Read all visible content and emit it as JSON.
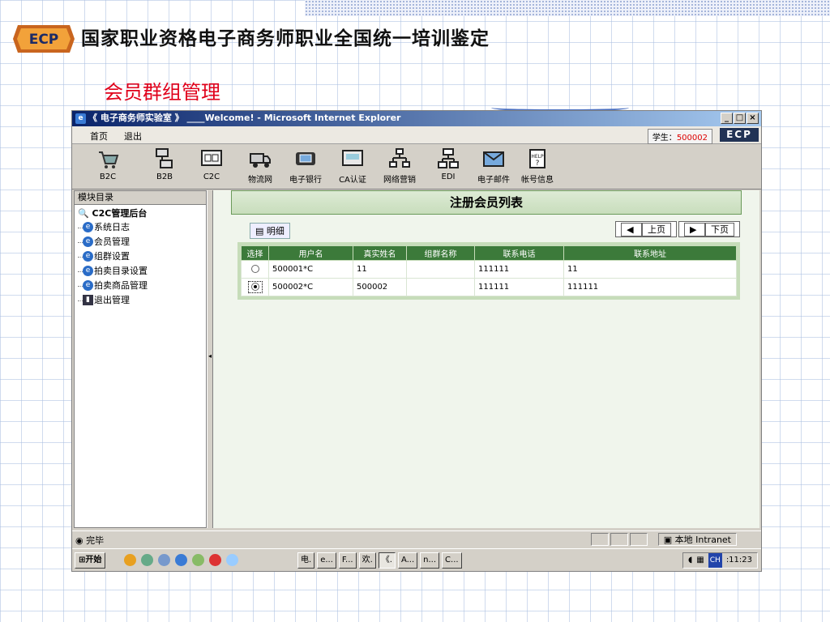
{
  "slide": {
    "title": "国家职业资格电子商务师职业全国统一培训鉴定",
    "subtitle": "会员群组管理",
    "logo_text": "ECP"
  },
  "window": {
    "title": "《 电子商务师实验室 》 ____Welcome! - Microsoft Internet Explorer",
    "controls": [
      "_",
      "□",
      "×"
    ]
  },
  "menubar": {
    "items": [
      "首页",
      "退出"
    ],
    "student_label": "学生：",
    "student_id": "500002",
    "brand": "ECP"
  },
  "toolbar": {
    "items": [
      {
        "label": "B2C",
        "icon": "cart-icon"
      },
      {
        "label": "B2B",
        "icon": "network-icon"
      },
      {
        "label": "C2C",
        "icon": "exchange-icon"
      },
      {
        "label": "物流网",
        "icon": "truck-icon"
      },
      {
        "label": "电子银行",
        "icon": "bank-icon"
      },
      {
        "label": "CA认证",
        "icon": "certificate-icon"
      },
      {
        "label": "网络营销",
        "icon": "marketing-icon"
      },
      {
        "label": "EDI",
        "icon": "edi-icon"
      },
      {
        "label": "电子邮件",
        "icon": "mail-icon"
      },
      {
        "label": "帐号信息",
        "icon": "help-icon"
      }
    ]
  },
  "sidebar": {
    "header": "模块目录",
    "root": "C2C管理后台",
    "items": [
      "系统日志",
      "会员管理",
      "组群设置",
      "拍卖目录设置",
      "拍卖商品管理",
      "退出管理"
    ]
  },
  "content": {
    "title": "注册会员列表",
    "detail_button": "明细",
    "prev_page": "上页",
    "next_page": "下页",
    "columns": [
      "选择",
      "用户名",
      "真实姓名",
      "组群名称",
      "联系电话",
      "联系地址"
    ],
    "rows": [
      {
        "selected": false,
        "username": "500001*C",
        "realname": "11",
        "group": "",
        "phone": "111111",
        "address": "11"
      },
      {
        "selected": true,
        "username": "500002*C",
        "realname": "500002",
        "group": "",
        "phone": "111111",
        "address": "111111"
      }
    ]
  },
  "statusbar": {
    "status": "完毕",
    "zone": "本地 Intranet"
  },
  "taskbar": {
    "start": "开始",
    "tasks": [
      "电.",
      "e...",
      "F...",
      "欢.",
      "《.",
      "A...",
      "n...",
      "C..."
    ],
    "lang": "CH",
    "clock": ":11:23"
  },
  "colors": {
    "header_green": "#3c7a3a",
    "title_red": "#e0001a",
    "titlebar_blue": "#0a246a"
  }
}
